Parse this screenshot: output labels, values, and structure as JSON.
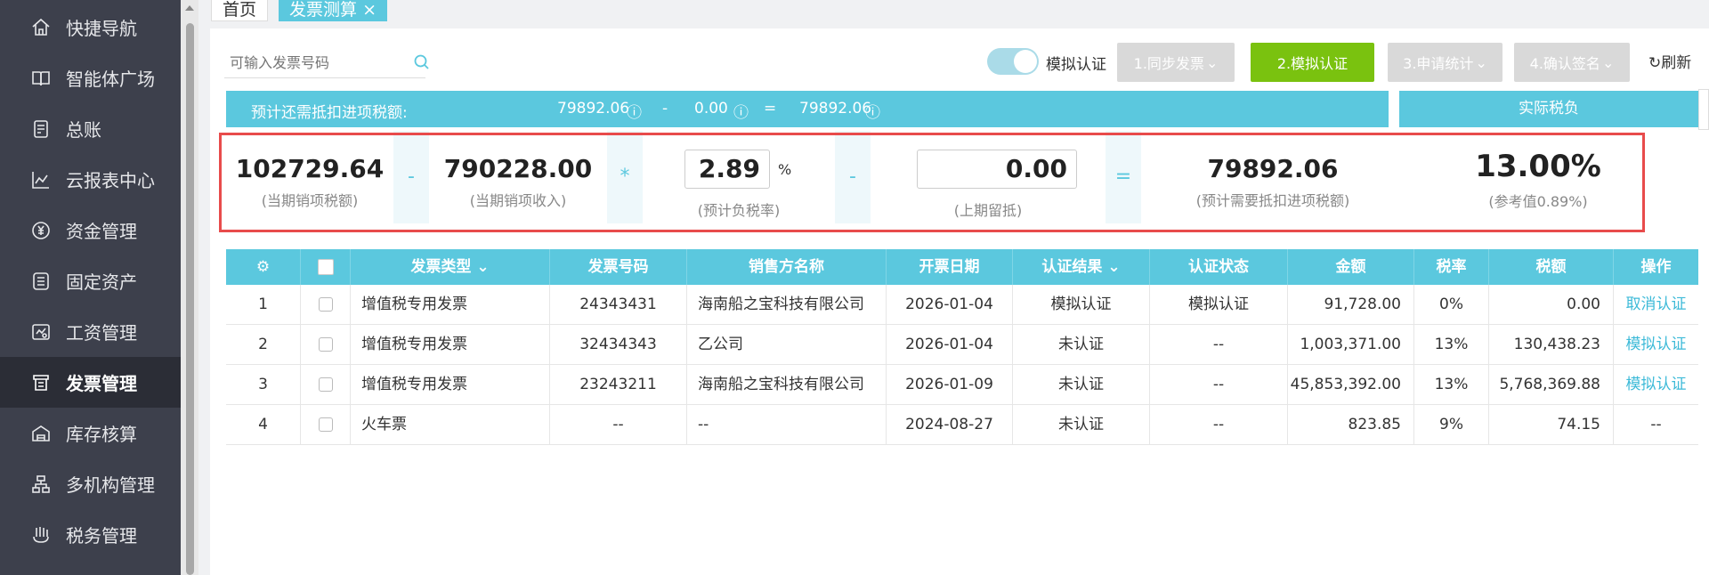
{
  "sidebar": {
    "items": [
      {
        "label": "快捷导航",
        "icon": "home-icon"
      },
      {
        "label": "智能体广场",
        "icon": "book-icon"
      },
      {
        "label": "总账",
        "icon": "ledger-icon"
      },
      {
        "label": "云报表中心",
        "icon": "chart-icon"
      },
      {
        "label": "资金管理",
        "icon": "money-icon"
      },
      {
        "label": "固定资产",
        "icon": "asset-icon"
      },
      {
        "label": "工资管理",
        "icon": "salary-icon"
      },
      {
        "label": "发票管理",
        "icon": "invoice-icon",
        "active": true
      },
      {
        "label": "库存核算",
        "icon": "warehouse-icon"
      },
      {
        "label": "多机构管理",
        "icon": "org-icon"
      },
      {
        "label": "税务管理",
        "icon": "tax-icon"
      }
    ]
  },
  "tabs": {
    "home": "首页",
    "active": "发票测算",
    "close": "×"
  },
  "toolbar": {
    "search_placeholder": "可输入发票号码",
    "toggle_label": "模拟认证",
    "steps": [
      "1.同步发票",
      "2.模拟认证",
      "3.申请统计",
      "4.确认签名"
    ],
    "refresh": "刷新"
  },
  "summary": {
    "label": "预计还需抵扣进项税额:",
    "v1": "79892.06",
    "op1": "-",
    "v2": "0.00",
    "op2": "=",
    "v3": "79892.06",
    "actual_label": "实际税负"
  },
  "calc": {
    "output_tax": {
      "value": "102729.64",
      "label": "(当期销项税额)"
    },
    "op_minus1": "-",
    "sales_income": {
      "value": "790228.00",
      "label": "(当期销项收入)"
    },
    "op_mul": "*",
    "tax_rate": {
      "value": "2.89",
      "unit": "%",
      "label": "(预计负税率)"
    },
    "op_minus2": "-",
    "last_credit": {
      "value": "0.00",
      "label": "(上期留抵)"
    },
    "op_eq": "=",
    "need_deduct": {
      "value": "79892.06",
      "label": "(预计需要抵扣进项税额)"
    },
    "actual_rate": {
      "value": "13.00%",
      "label": "(参考值0.89%)"
    }
  },
  "table": {
    "headers": {
      "type": "发票类型",
      "number": "发票号码",
      "seller": "销售方名称",
      "date": "开票日期",
      "result": "认证结果",
      "status": "认证状态",
      "amount": "金额",
      "rate": "税率",
      "tax": "税额",
      "op": "操作"
    },
    "rows": [
      {
        "idx": "1",
        "type": "增值税专用发票",
        "number": "24343431",
        "seller": "海南船之宝科技有限公司",
        "date": "2026-01-04",
        "result": "模拟认证",
        "status": "模拟认证",
        "amount": "91,728.00",
        "rate": "0%",
        "tax": "0.00",
        "op": "取消认证"
      },
      {
        "idx": "2",
        "type": "增值税专用发票",
        "number": "32434343",
        "seller": "乙公司",
        "date": "2026-01-04",
        "result": "未认证",
        "status": "--",
        "amount": "1,003,371.00",
        "rate": "13%",
        "tax": "130,438.23",
        "op": "模拟认证"
      },
      {
        "idx": "3",
        "type": "增值税专用发票",
        "number": "23243211",
        "seller": "海南船之宝科技有限公司",
        "date": "2026-01-09",
        "result": "未认证",
        "status": "--",
        "amount": "45,853,392.00",
        "rate": "13%",
        "tax": "5,768,369.88",
        "op": "模拟认证"
      },
      {
        "idx": "4",
        "type": "火车票",
        "number": "--",
        "seller": "--",
        "date": "2024-08-27",
        "result": "未认证",
        "status": "--",
        "amount": "823.85",
        "rate": "9%",
        "tax": "74.15",
        "op": "--"
      }
    ]
  },
  "colors": {
    "accent": "#5bc8de",
    "active_step": "#7ac20f",
    "sidebar": "#3d404c",
    "highlight_border": "#e84b4b"
  }
}
